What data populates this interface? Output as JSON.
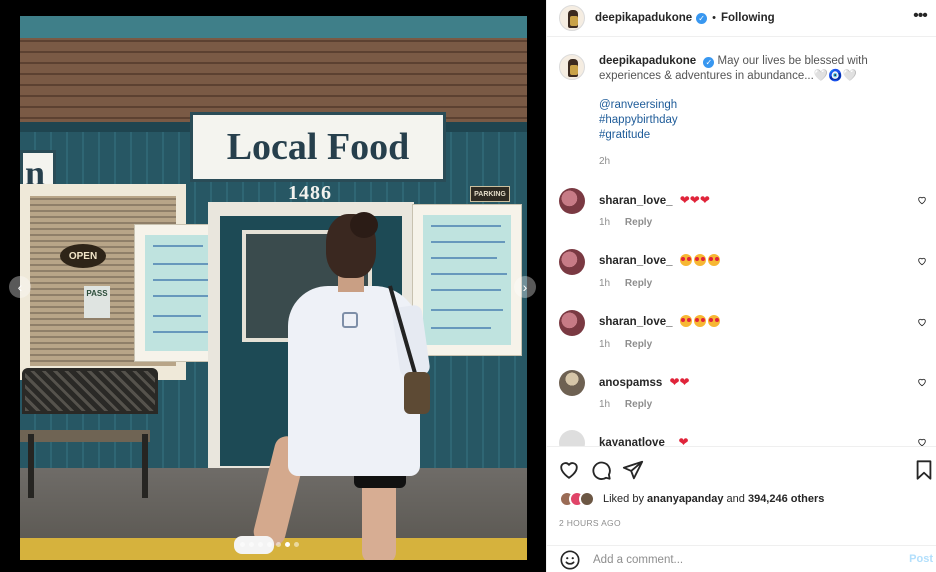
{
  "post": {
    "username": "deepikapadukone",
    "follow_state": "Following",
    "separator": "•"
  },
  "photo": {
    "sign_text": "Local Food",
    "sign_partial": "n",
    "address_number": "1486",
    "open_sign": "OPEN",
    "pass_sign": "PASS",
    "parking_sign": "PARKING",
    "carousel_total": 7,
    "carousel_active": 6
  },
  "caption": {
    "username": "deepikapadukone",
    "text": "May our lives be blessed with experiences & adventures in abundance...🤍🧿🤍",
    "mention": "@ranveersingh",
    "hashtags": [
      "#happybirthday",
      "#gratitude"
    ],
    "time": "2h"
  },
  "comments": [
    {
      "username": "sharan_love_",
      "text": "❤️❤️❤️",
      "time": "1h",
      "reply_label": "Reply",
      "emoji_type": "heart",
      "emoji_count": 3
    },
    {
      "username": "sharan_love_",
      "text": "😍😍😍",
      "time": "1h",
      "reply_label": "Reply",
      "emoji_type": "face",
      "emoji_count": 3
    },
    {
      "username": "sharan_love_",
      "text": "😍😍😍",
      "time": "1h",
      "reply_label": "Reply",
      "emoji_type": "face",
      "emoji_count": 3
    },
    {
      "username": "anospamss",
      "text": "❤️❤️",
      "time": "1h",
      "reply_label": "Reply",
      "emoji_type": "heart",
      "emoji_count": 2
    },
    {
      "username": "kayanatlove_",
      "text": "❤️",
      "time": "",
      "reply_label": "",
      "emoji_type": "heart",
      "emoji_count": 1
    }
  ],
  "likes": {
    "prefix": "Liked by",
    "user": "ananyapanday",
    "middle": "and",
    "others": "394,246 others"
  },
  "timestamp": "2 HOURS AGO",
  "add_comment": {
    "placeholder": "Add a comment...",
    "post_label": "Post"
  },
  "icons": {
    "like": "heart-icon",
    "comment": "comment-icon",
    "share": "share-icon",
    "save": "bookmark-icon",
    "more": "more-options-icon",
    "emoji": "emoji-icon"
  },
  "colors": {
    "link": "#1f5c99",
    "verified": "#3897f0",
    "heart": "#e0243a",
    "post_button": "#b2dffc"
  }
}
